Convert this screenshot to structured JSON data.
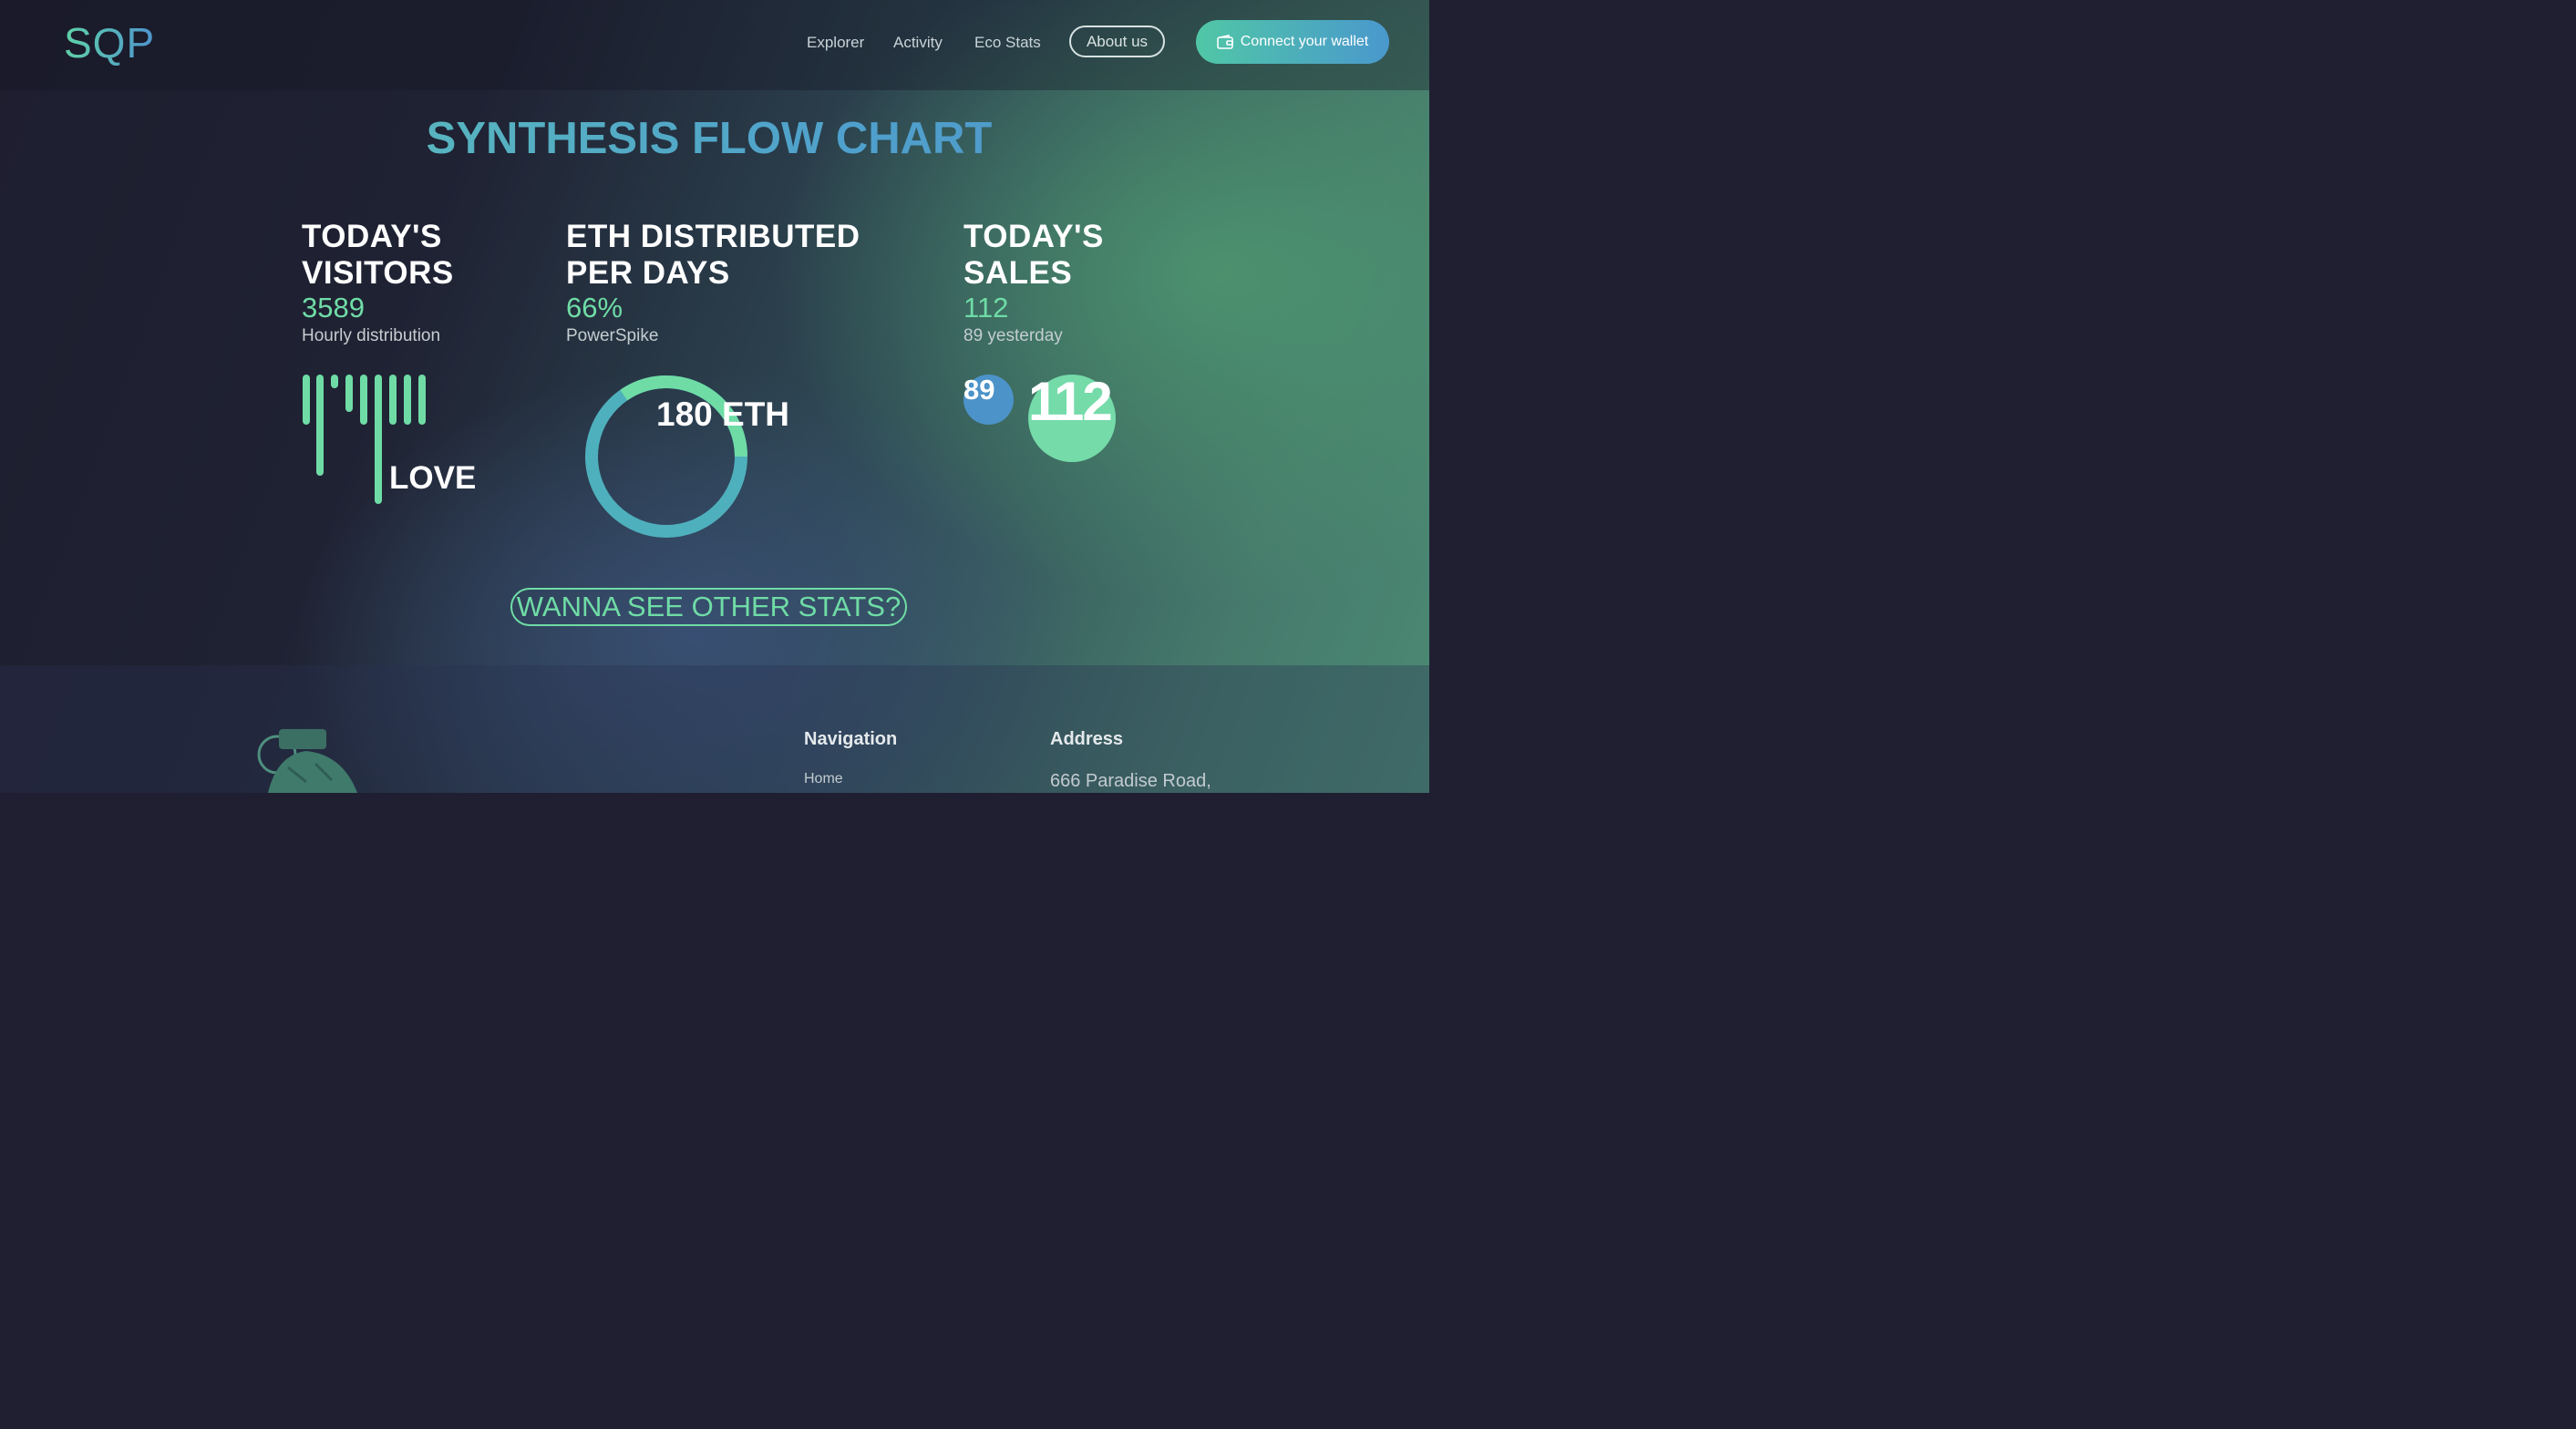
{
  "brand": "SQP",
  "nav": {
    "explorer": "Explorer",
    "activity": "Activity",
    "eco_stats": "Eco Stats",
    "about": "About us",
    "connect": "Connect your wallet",
    "connect_icon": "wallet-icon"
  },
  "hero": {
    "title": "SYNTHESIS FLOW CHART"
  },
  "stats": {
    "visitors": {
      "title_line1": "TODAY'S",
      "title_line2": "VISITORS",
      "value": "3589",
      "sub": "Hourly distribution",
      "chart_label": "LOVE"
    },
    "eth": {
      "title_line1": "ETH DISTRIBUTED",
      "title_line2": "PER DAYS",
      "value": "66%",
      "sub": "PowerSpike",
      "donut_label": "180 ETH"
    },
    "sales": {
      "title_line1": "TODAY'S",
      "title_line2": "SALES",
      "value": "112",
      "sub": "89 yesterday",
      "yesterday_bubble": "89",
      "today_bubble": "112"
    }
  },
  "cta": "WANNA SEE OTHER STATS?",
  "footer": {
    "navigation_heading": "Navigation",
    "home": "Home",
    "address_heading": "Address",
    "address_line1": "666 Paradise Road,"
  },
  "colors": {
    "accent_green": "#6fdca6",
    "accent_blue": "#4e94cf",
    "donut_teal": "#4fb0bd"
  }
}
